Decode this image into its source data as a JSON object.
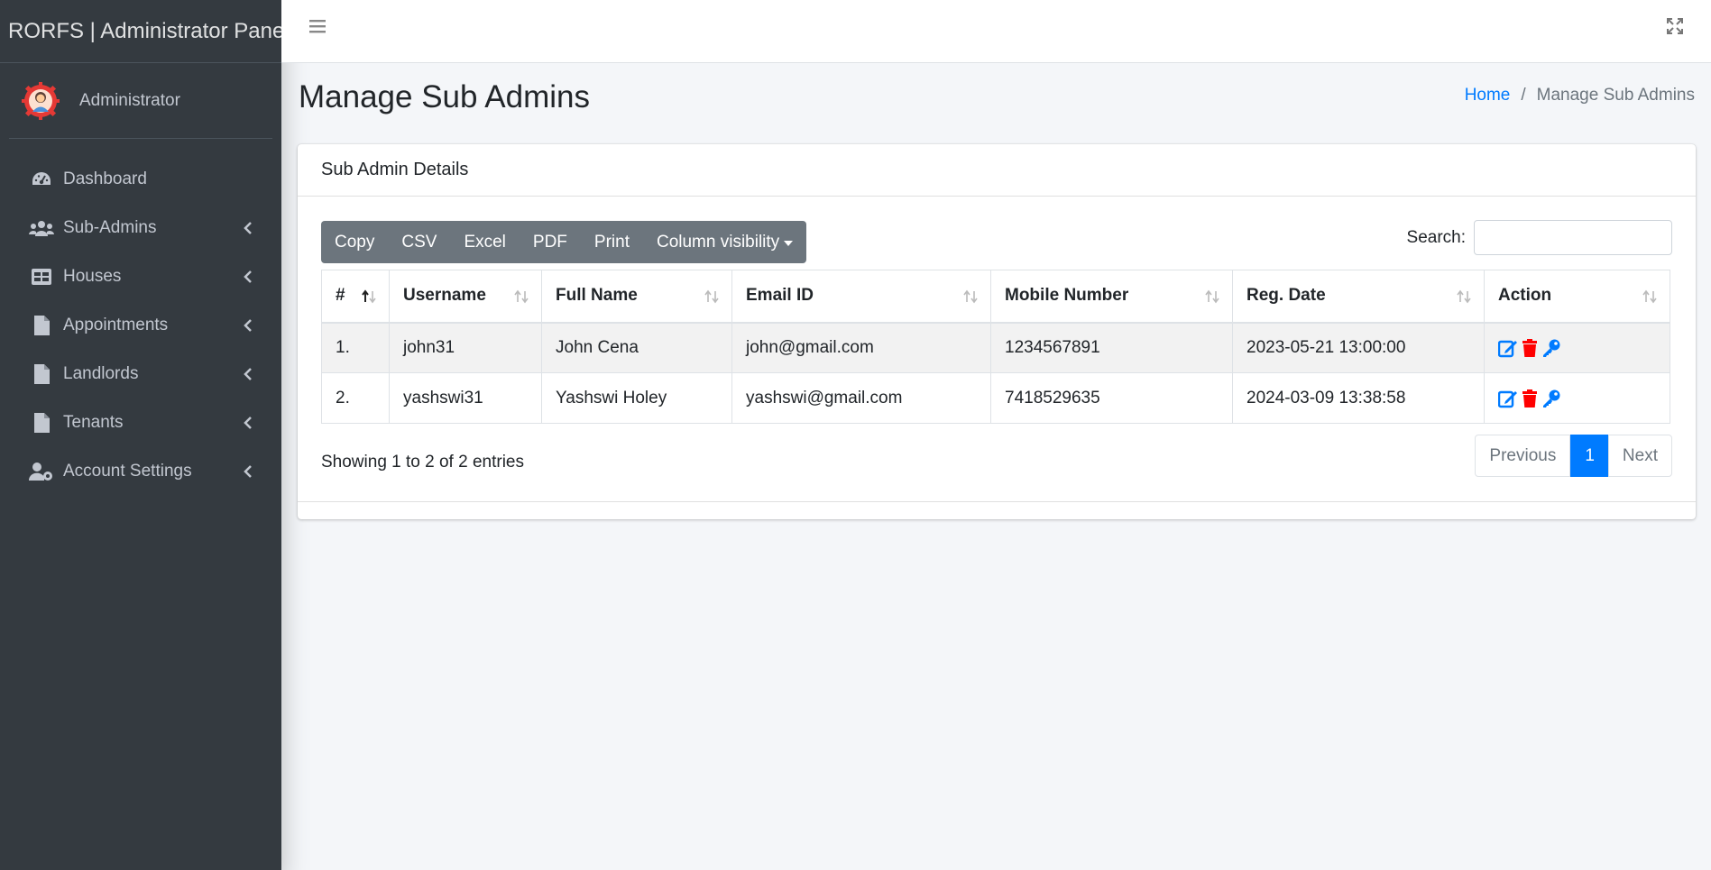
{
  "brand": {
    "title": "RORFS | Administrator Panel"
  },
  "user": {
    "name": "Administrator"
  },
  "sidebar": {
    "items": [
      {
        "label": "Dashboard",
        "icon": "tachometer-icon",
        "has_children": false
      },
      {
        "label": "Sub-Admins",
        "icon": "users-icon",
        "has_children": true
      },
      {
        "label": "Houses",
        "icon": "table-icon",
        "has_children": true
      },
      {
        "label": "Appointments",
        "icon": "file-icon",
        "has_children": true
      },
      {
        "label": "Landlords",
        "icon": "file-icon",
        "has_children": true
      },
      {
        "label": "Tenants",
        "icon": "file-icon",
        "has_children": true
      },
      {
        "label": "Account Settings",
        "icon": "user-cog-icon",
        "has_children": true
      }
    ]
  },
  "header": {
    "title": "Manage Sub Admins",
    "breadcrumb": {
      "home": "Home",
      "separator": "/",
      "current": "Manage Sub Admins"
    }
  },
  "card": {
    "title": "Sub Admin Details",
    "buttons": [
      "Copy",
      "CSV",
      "Excel",
      "PDF",
      "Print",
      "Column visibility"
    ],
    "search": {
      "label": "Search:",
      "value": "",
      "placeholder": ""
    },
    "table": {
      "columns": [
        "#",
        "Username",
        "Full Name",
        "Email ID",
        "Mobile Number",
        "Reg. Date",
        "Action"
      ],
      "rows": [
        {
          "num": "1.",
          "username": "john31",
          "full_name": "John Cena",
          "email": "john@gmail.com",
          "mobile": "1234567891",
          "reg_date": "2023-05-21 13:00:00"
        },
        {
          "num": "2.",
          "username": "yashswi31",
          "full_name": "Yashswi Holey",
          "email": "yashswi@gmail.com",
          "mobile": "7418529635",
          "reg_date": "2024-03-09 13:38:58"
        }
      ]
    },
    "info": "Showing 1 to 2 of 2 entries",
    "pagination": {
      "previous": "Previous",
      "current": "1",
      "next": "Next"
    }
  },
  "colors": {
    "sidebar": "#343a40",
    "primary": "#007bff",
    "danger": "#ff0000",
    "button_group": "#6c757d",
    "background": "#f4f6f9"
  }
}
